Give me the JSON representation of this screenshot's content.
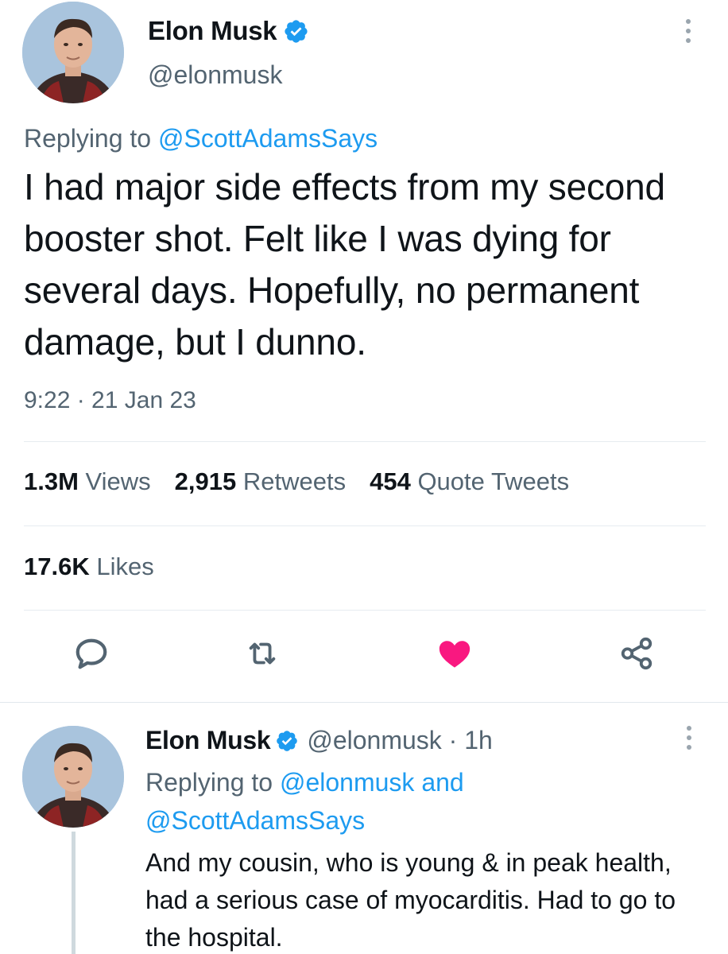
{
  "main_tweet": {
    "author_name": "Elon Musk",
    "handle": "@elonmusk",
    "verified": true,
    "replying_prefix": "Replying to ",
    "replying_to": "@ScottAdamsSays",
    "text": "I had major side effects from my second booster shot. Felt like I was dying for several days. Hopefully, no permanent damage, but I dunno.",
    "timestamp": "9:22 · 21 Jan 23",
    "stats": {
      "views_count": "1.3M",
      "views_label": " Views",
      "retweets_count": "2,915",
      "retweets_label": " Retweets",
      "quotes_count": "454",
      "quotes_label": " Quote Tweets",
      "likes_count": "17.6K",
      "likes_label": " Likes"
    },
    "actions": {
      "reply_icon": "reply-icon",
      "retweet_icon": "retweet-icon",
      "like_icon": "heart-filled-icon",
      "share_icon": "share-icon"
    },
    "liked": true
  },
  "reply_tweet": {
    "author_name": "Elon Musk",
    "handle_time": "@elonmusk · 1h",
    "verified": true,
    "replying_prefix": "Replying to ",
    "replying_to_1": "@elonmusk",
    "replying_joiner": " and",
    "replying_to_2": "@ScottAdamsSays",
    "text": "And my cousin, who is young & in peak health, had a serious case of myocarditis. Had to go to the hospital."
  },
  "colors": {
    "accent": "#1d9bf0",
    "like": "#f91880",
    "secondary_text": "#536471",
    "primary_text": "#0f1419"
  }
}
